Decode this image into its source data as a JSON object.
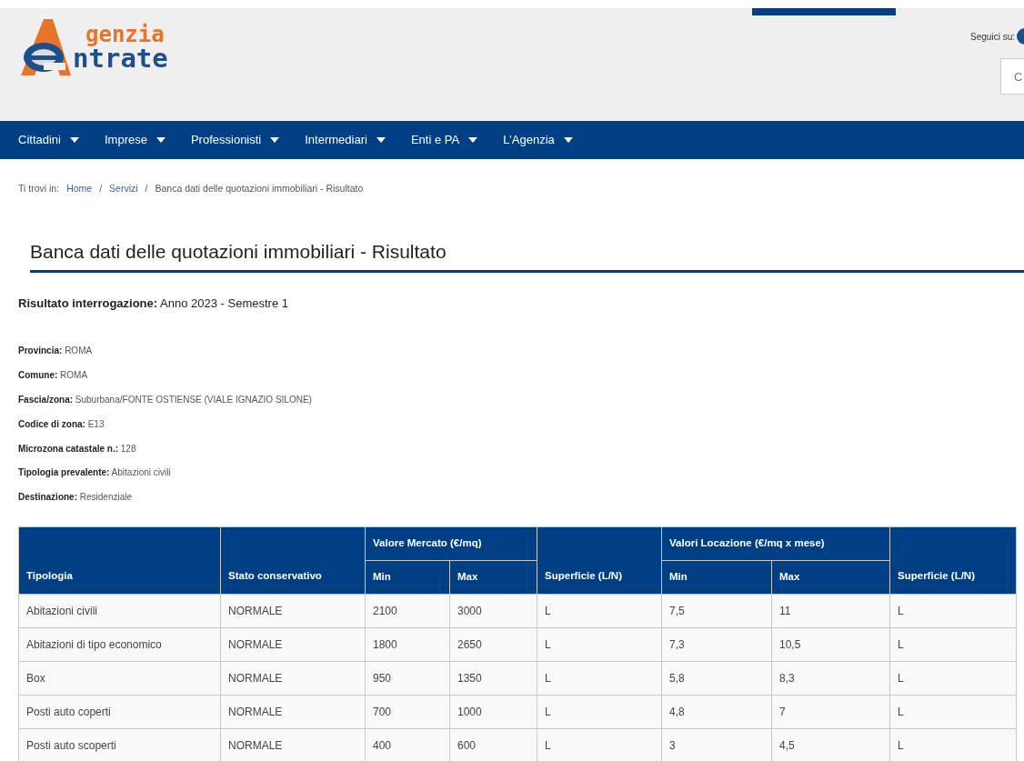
{
  "header": {
    "logo_top": "genzia",
    "logo_bottom": "ntrate",
    "follow_label": "Seguici su:",
    "search": {
      "placeholder": "C"
    }
  },
  "nav": [
    {
      "label": "Cittadini"
    },
    {
      "label": "Imprese"
    },
    {
      "label": "Professionisti"
    },
    {
      "label": "Intermediari"
    },
    {
      "label": "Enti e PA"
    },
    {
      "label": "L'Agenzia"
    }
  ],
  "breadcrumb": {
    "prefix": "Ti trovi in:",
    "separators": [
      "/",
      "/"
    ],
    "items": [
      {
        "label": "Home",
        "link": true
      },
      {
        "label": "Servizi",
        "link": true
      },
      {
        "label": "Banca dati delle quotazioni immobiliari - Risultato",
        "link": false
      }
    ]
  },
  "title": "Banca dati delle quotazioni immobiliari - Risultato",
  "result": {
    "label": "Risultato interrogazione:",
    "value": "Anno 2023 - Semestre 1"
  },
  "details": [
    {
      "label": "Provincia:",
      "value": "ROMA"
    },
    {
      "label": "Comune:",
      "value": "ROMA"
    },
    {
      "label": "Fascia/zona:",
      "value": "Suburbana/FONTE OSTIENSE (VIALE IGNAZIO SILONE)"
    },
    {
      "label": "Codice di zona:",
      "value": "E13"
    },
    {
      "label": "Microzona catastale n.:",
      "value": "128"
    },
    {
      "label": "Tipologia prevalente:",
      "value": "Abitazioni civili"
    },
    {
      "label": "Destinazione:",
      "value": "Residenziale"
    }
  ],
  "table": {
    "group_headers": [
      "Valore Mercato (€/mq)",
      "Valori Locazione (€/mq x mese)"
    ],
    "columns": [
      "Tipologia",
      "Stato conservativo",
      "Min",
      "Max",
      "Superficie (L/N)",
      "Min",
      "Max",
      "Superficie (L/N)"
    ],
    "rows": [
      [
        "Abitazioni civili",
        "NORMALE",
        "2100",
        "3000",
        "L",
        "7,5",
        "11",
        "L"
      ],
      [
        "Abitazioni di tipo economico",
        "NORMALE",
        "1800",
        "2650",
        "L",
        "7,3",
        "10,5",
        "L"
      ],
      [
        "Box",
        "NORMALE",
        "950",
        "1350",
        "L",
        "5,8",
        "8,3",
        "L"
      ],
      [
        "Posti auto coperti",
        "NORMALE",
        "700",
        "1000",
        "L",
        "4,8",
        "7",
        "L"
      ],
      [
        "Posti auto scoperti",
        "NORMALE",
        "400",
        "600",
        "L",
        "3",
        "4,5",
        "L"
      ]
    ]
  }
}
